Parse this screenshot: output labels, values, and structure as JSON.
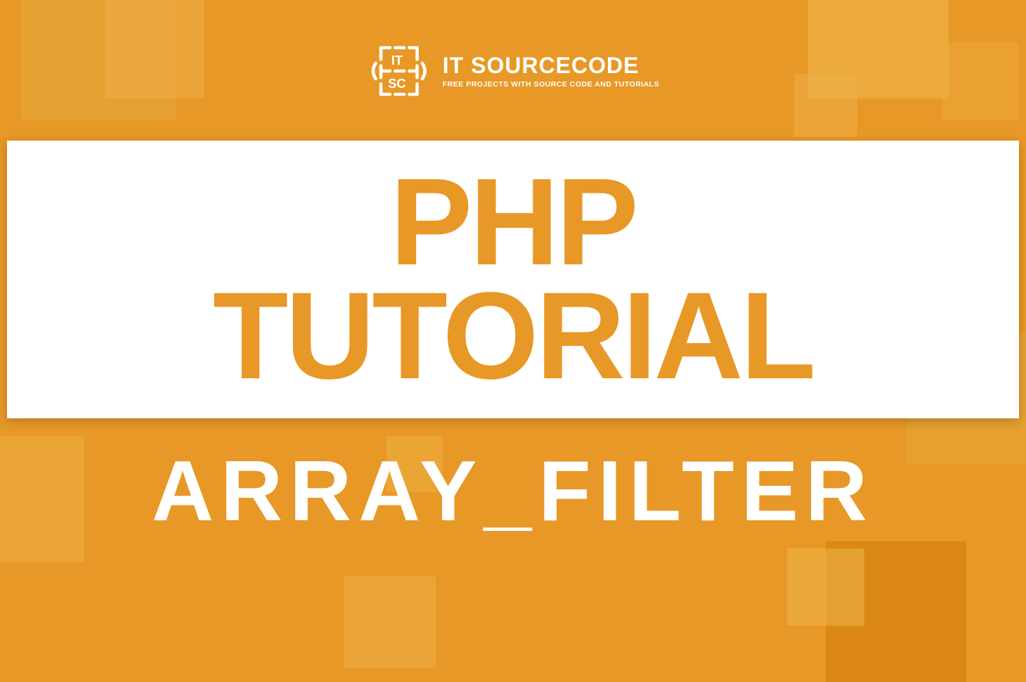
{
  "brand": {
    "title": "IT SOURCECODE",
    "subtitle": "FREE PROJECTS WITH SOURCE CODE AND TUTORIALS"
  },
  "hero": {
    "line1": "PHP",
    "line2": "TUTORIAL"
  },
  "topic": "ARRAY_FILTER",
  "colors": {
    "primary": "#e89826",
    "white": "#ffffff"
  }
}
